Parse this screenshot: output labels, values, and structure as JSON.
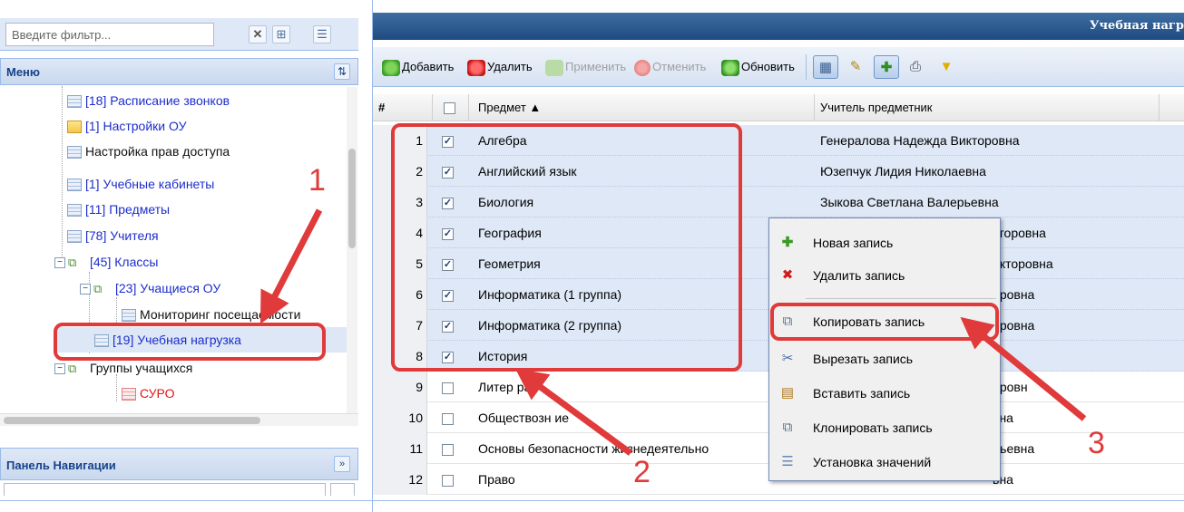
{
  "filter": {
    "placeholder": "Введите фильтр..."
  },
  "menu": {
    "title": "Меню"
  },
  "tree": {
    "items": [
      {
        "label": "[18] Расписание звонков"
      },
      {
        "label": "[1] Настройки ОУ"
      },
      {
        "label": "Настройка прав доступа"
      },
      {
        "label": "[1] Учебные кабинеты"
      },
      {
        "label": "[11] Предметы"
      },
      {
        "label": "[78] Учителя"
      },
      {
        "label": "[45] Классы"
      },
      {
        "label": "[23] Учащиеся ОУ"
      },
      {
        "label": "Мониторинг посещаемости"
      },
      {
        "label": "[19] Учебная нагрузка"
      },
      {
        "label": "Группы учащихся"
      },
      {
        "label": "СУРО"
      }
    ]
  },
  "nav_panel": {
    "title": "Панель Навигации"
  },
  "main": {
    "title": "Учебная нагр"
  },
  "toolbar": {
    "add": "Добавить",
    "delete": "Удалить",
    "apply": "Применить",
    "cancel": "Отменить",
    "refresh": "Обновить"
  },
  "grid": {
    "col_num": "#",
    "col_subject": "Предмет ▲",
    "col_teacher": "Учитель предметник",
    "rows": [
      {
        "n": "1",
        "checked": true,
        "subject": "Алгебра",
        "teacher": "Генералова Надежда Викторовна"
      },
      {
        "n": "2",
        "checked": true,
        "subject": "Английский язык",
        "teacher": "Юзепчук Лидия Николаевна"
      },
      {
        "n": "3",
        "checked": true,
        "subject": "Биология",
        "teacher": "Зыкова Светлана Валерьевна"
      },
      {
        "n": "4",
        "checked": true,
        "subject": "География",
        "teacher": "кторовна"
      },
      {
        "n": "5",
        "checked": true,
        "subject": "Геометрия",
        "teacher": "икторовна"
      },
      {
        "n": "6",
        "checked": true,
        "subject": "Информатика (1 группа)",
        "teacher": "ировна"
      },
      {
        "n": "7",
        "checked": true,
        "subject": "Информатика (2 группа)",
        "teacher": "ировна"
      },
      {
        "n": "8",
        "checked": true,
        "subject": "История",
        "teacher": "а"
      },
      {
        "n": "9",
        "checked": false,
        "subject": "Литер   ра",
        "teacher": "ировн"
      },
      {
        "n": "10",
        "checked": false,
        "subject": "Обществозн   ие",
        "teacher": "вна"
      },
      {
        "n": "11",
        "checked": false,
        "subject": "Основы безопасности жизнедеятельно",
        "teacher": "льевна"
      },
      {
        "n": "12",
        "checked": false,
        "subject": "Право",
        "teacher": "вна"
      }
    ]
  },
  "context_menu": {
    "new": "Новая запись",
    "delete": "Удалить запись",
    "copy": "Копировать запись",
    "cut": "Вырезать запись",
    "paste": "Вставить запись",
    "clone": "Клонировать запись",
    "set_values": "Установка значений"
  },
  "annotations": {
    "a1": "1",
    "a2": "2",
    "a3": "3"
  },
  "colors": {
    "annotation": "#e03a3a",
    "link": "#1d2dcc",
    "header": "#15428b",
    "selection": "#dfe8f6"
  }
}
